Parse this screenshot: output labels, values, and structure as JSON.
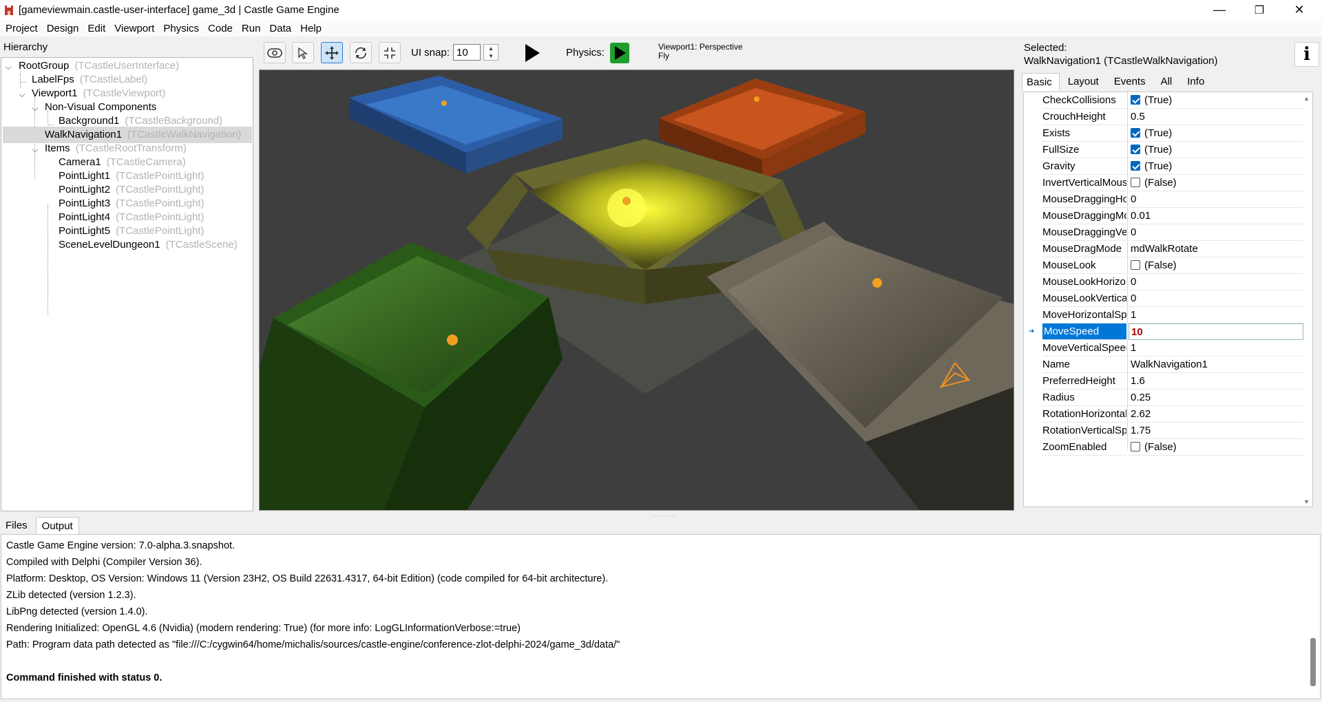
{
  "window": {
    "title": "[gameviewmain.castle-user-interface] game_3d | Castle Game Engine",
    "minimize": "—",
    "maximize": "❐",
    "close": "✕"
  },
  "menu": [
    "Project",
    "Design",
    "Edit",
    "Viewport",
    "Physics",
    "Code",
    "Run",
    "Data",
    "Help"
  ],
  "hierarchy": {
    "title": "Hierarchy",
    "items": [
      {
        "name": "RootGroup",
        "type": "(TCastleUserInterface)"
      },
      {
        "name": "LabelFps",
        "type": "(TCastleLabel)"
      },
      {
        "name": "Viewport1",
        "type": "(TCastleViewport)"
      },
      {
        "name": "Non-Visual Components",
        "type": ""
      },
      {
        "name": "Background1",
        "type": "(TCastleBackground)"
      },
      {
        "name": "WalkNavigation1",
        "type": "(TCastleWalkNavigation)"
      },
      {
        "name": "Items",
        "type": "(TCastleRootTransform)"
      },
      {
        "name": "Camera1",
        "type": "(TCastleCamera)"
      },
      {
        "name": "PointLight1",
        "type": "(TCastlePointLight)"
      },
      {
        "name": "PointLight2",
        "type": "(TCastlePointLight)"
      },
      {
        "name": "PointLight3",
        "type": "(TCastlePointLight)"
      },
      {
        "name": "PointLight4",
        "type": "(TCastlePointLight)"
      },
      {
        "name": "PointLight5",
        "type": "(TCastlePointLight)"
      },
      {
        "name": "SceneLevelDungeon1",
        "type": "(TCastleScene)"
      }
    ]
  },
  "toolbar": {
    "snap_label": "UI snap:",
    "snap_value": "10",
    "physics_label": "Physics:",
    "viewport_info_line1": "Viewport1: Perspective",
    "viewport_info_line2": "Fly"
  },
  "inspector": {
    "selected_label": "Selected:",
    "selected_value": "WalkNavigation1 (TCastleWalkNavigation)",
    "tabs": [
      "Basic",
      "Layout",
      "Events",
      "All",
      "Info"
    ],
    "properties": [
      {
        "name": "CheckCollisions",
        "value": "(True)",
        "check": "on"
      },
      {
        "name": "CrouchHeight",
        "value": "0.5",
        "check": ""
      },
      {
        "name": "Exists",
        "value": "(True)",
        "check": "on"
      },
      {
        "name": "FullSize",
        "value": "(True)",
        "check": "on"
      },
      {
        "name": "Gravity",
        "value": "(True)",
        "check": "on"
      },
      {
        "name": "InvertVerticalMouseLook",
        "value": "(False)",
        "check": "off"
      },
      {
        "name": "MouseDraggingHorizontalRotationSpeed",
        "value": "0",
        "check": ""
      },
      {
        "name": "MouseDraggingMoveSpeed",
        "value": "0.01",
        "check": ""
      },
      {
        "name": "MouseDraggingVerticalRotationSpeed",
        "value": "0",
        "check": ""
      },
      {
        "name": "MouseDragMode",
        "value": "mdWalkRotate",
        "check": ""
      },
      {
        "name": "MouseLook",
        "value": "(False)",
        "check": "off"
      },
      {
        "name": "MouseLookHorizontalSensitivity",
        "value": "0",
        "check": ""
      },
      {
        "name": "MouseLookVerticalSensitivity",
        "value": "0",
        "check": ""
      },
      {
        "name": "MoveHorizontalSpeed",
        "value": "1",
        "check": ""
      },
      {
        "name": "MoveSpeed",
        "value": "10",
        "check": ""
      },
      {
        "name": "MoveVerticalSpeed",
        "value": "1",
        "check": ""
      },
      {
        "name": "Name",
        "value": "WalkNavigation1",
        "check": ""
      },
      {
        "name": "PreferredHeight",
        "value": "1.6",
        "check": ""
      },
      {
        "name": "Radius",
        "value": "0.25",
        "check": ""
      },
      {
        "name": "RotationHorizontalSpeed",
        "value": "2.62",
        "check": ""
      },
      {
        "name": "RotationVerticalSpeed",
        "value": "1.75",
        "check": ""
      },
      {
        "name": "ZoomEnabled",
        "value": "(False)",
        "check": "off"
      }
    ]
  },
  "bottom": {
    "tabs": [
      "Files",
      "Output"
    ],
    "lines": [
      " Castle Game Engine version: 7.0-alpha.3.snapshot.",
      " Compiled with Delphi (Compiler Version 36).",
      " Platform: Desktop, OS Version: Windows 11 (Version 23H2, OS Build 22631.4317, 64-bit Edition) (code compiled for 64-bit architecture).",
      "ZLib detected (version 1.2.3).",
      "LibPng detected (version 1.4.0).",
      "Rendering Initialized: OpenGL 4.6 (Nvidia) (modern rendering: True) (for more info: LogGLInformationVerbose:=true)",
      "Path: Program data path detected as \"file:///C:/cygwin64/home/michalis/sources/castle-engine/conference-zlot-delphi-2024/game_3d/data/\"",
      "",
      "Command finished with status 0."
    ]
  },
  "colors": {
    "selection": "#0078d7",
    "play_black": "#000000",
    "play_green": "#1e9e2e",
    "room_blue": "#3a78c8",
    "room_orange": "#c8551e",
    "room_yellow": "#d8d820",
    "room_green": "#58b040",
    "room_gray": "#a09a88"
  }
}
